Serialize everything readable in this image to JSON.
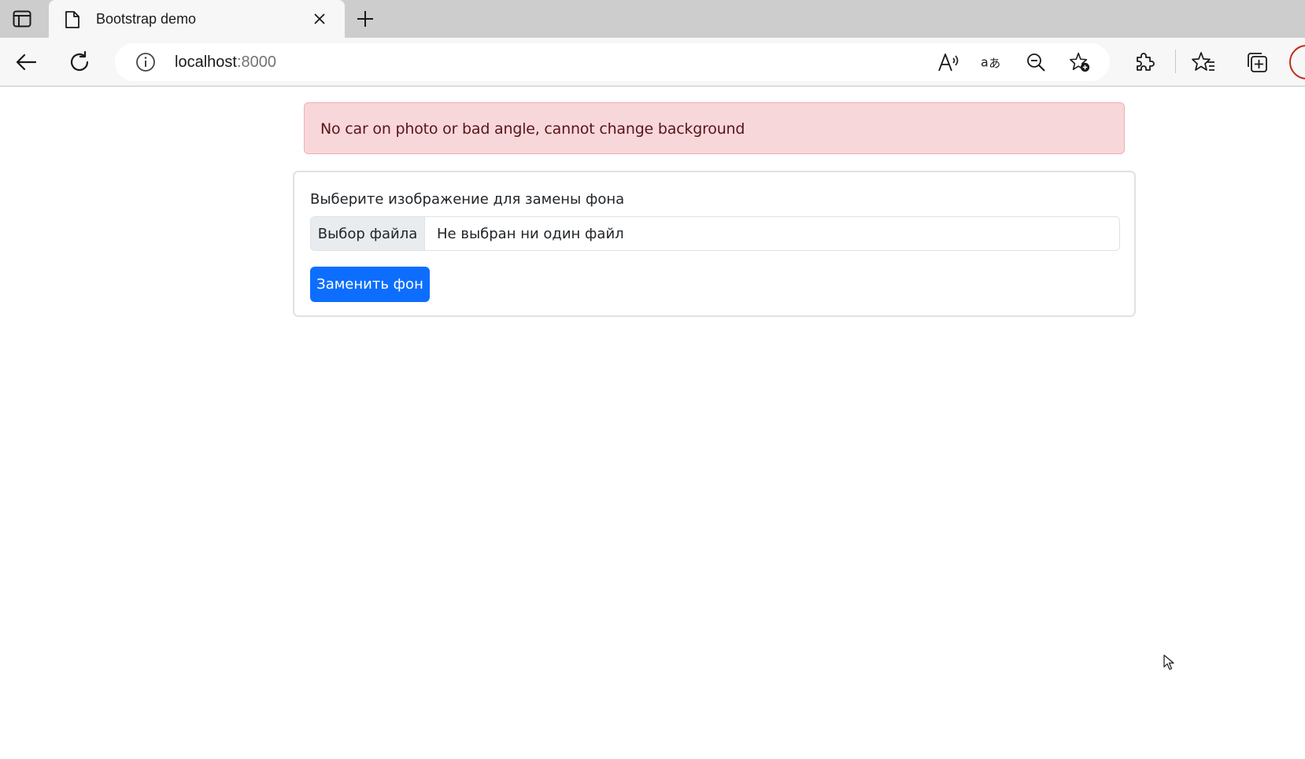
{
  "browser": {
    "tab": {
      "title": "Bootstrap demo"
    },
    "address": {
      "host": "localhost",
      "port": ":8000"
    },
    "icons": [
      "tab-actions-icon",
      "page-icon",
      "close-icon",
      "new-tab-icon",
      "back-icon",
      "refresh-icon",
      "site-info-icon",
      "read-aloud-icon",
      "translate-icon",
      "zoom-out-icon",
      "add-favorite-icon",
      "extensions-icon",
      "favorites-icon",
      "collections-icon",
      "profile-icon"
    ]
  },
  "alert": {
    "message": "No car on photo or bad angle, cannot change background",
    "color": "#f8d7da"
  },
  "form": {
    "label": "Выберите изображение для замены фона",
    "file_button": "Выбор файла",
    "file_status": "Не выбран ни один файл",
    "submit_label": "Заменить фон",
    "accent": "#0d6efd"
  }
}
